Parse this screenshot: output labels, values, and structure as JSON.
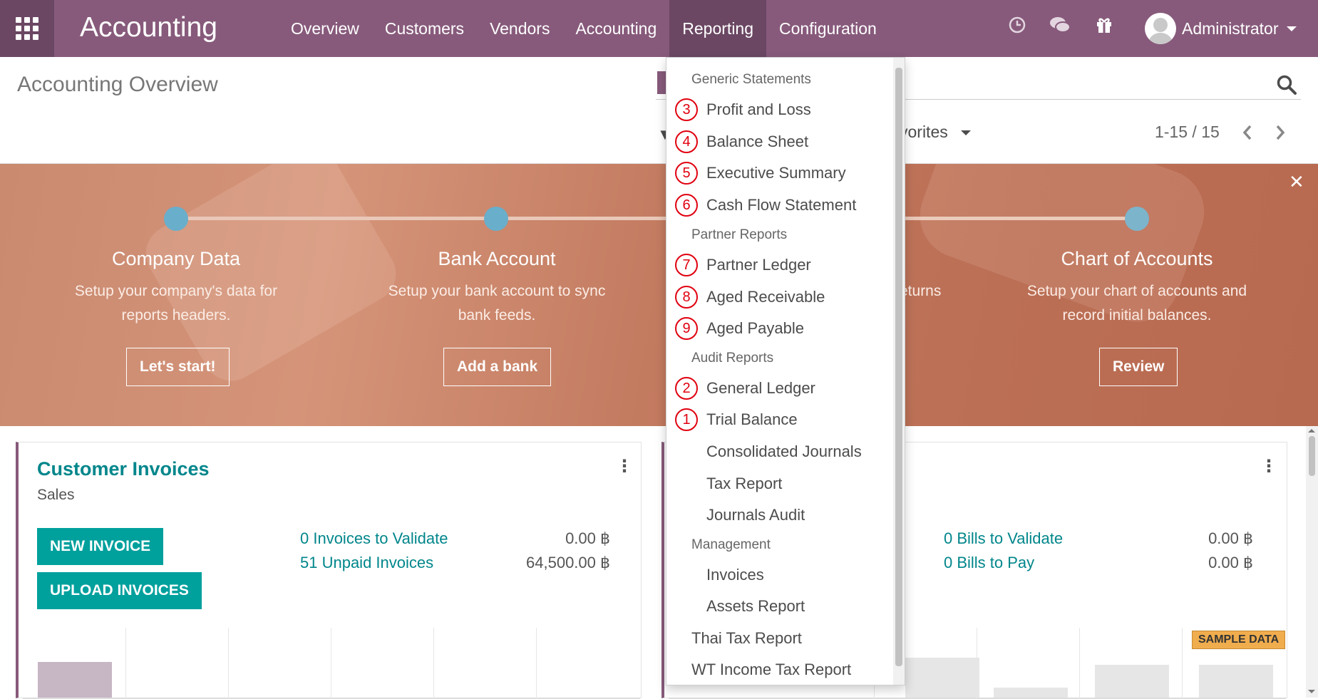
{
  "navbar": {
    "brand": "Accounting",
    "menu": [
      {
        "label": "Overview",
        "active": false
      },
      {
        "label": "Customers",
        "active": false
      },
      {
        "label": "Vendors",
        "active": false
      },
      {
        "label": "Accounting",
        "active": false
      },
      {
        "label": "Reporting",
        "active": true
      },
      {
        "label": "Configuration",
        "active": false
      }
    ],
    "icons": [
      "clock-icon",
      "chat-icon",
      "gift-icon"
    ],
    "user": "Administrator",
    "colors": {
      "primary": "#875a7b",
      "active": "#6b4763"
    }
  },
  "control_panel": {
    "title": "Accounting Overview",
    "favorites": "vorites",
    "pager": "1-15 / 15"
  },
  "banner": {
    "steps": [
      {
        "title": "Company Data",
        "desc1": "Setup your company's data for",
        "desc2": "reports headers.",
        "button": "Let's start!"
      },
      {
        "title": "Bank Account",
        "desc1": "Setup your bank account to sync",
        "desc2": "bank feeds.",
        "button": "Add a bank"
      },
      {
        "title": "",
        "desc1": "eturns",
        "desc2": "",
        "button": ""
      },
      {
        "title": "Chart of Accounts",
        "desc1": "Setup your chart of accounts and",
        "desc2": "record initial balances.",
        "button": "Review"
      }
    ],
    "close": "✕"
  },
  "cards": {
    "customer": {
      "title": "Customer Invoices",
      "subtitle": "Sales",
      "buttons": [
        "NEW INVOICE",
        "UPLOAD INVOICES"
      ],
      "rows": [
        {
          "label": "0 Invoices to Validate",
          "amount": "0.00 ฿"
        },
        {
          "label": "51 Unpaid Invoices",
          "amount": "64,500.00 ฿"
        }
      ]
    },
    "vendor": {
      "rows": [
        {
          "label": "0 Bills to Validate",
          "amount": "0.00 ฿"
        },
        {
          "label": "0 Bills to Pay",
          "amount": "0.00 ฿"
        }
      ],
      "badge": "SAMPLE DATA"
    }
  },
  "reporting_menu": {
    "sections": [
      {
        "header": "Generic Statements",
        "items": [
          {
            "num": "3",
            "label": "Profit and Loss"
          },
          {
            "num": "4",
            "label": "Balance Sheet"
          },
          {
            "num": "5",
            "label": "Executive Summary"
          },
          {
            "num": "6",
            "label": "Cash Flow Statement"
          }
        ]
      },
      {
        "header": "Partner Reports",
        "items": [
          {
            "num": "7",
            "label": "Partner Ledger"
          },
          {
            "num": "8",
            "label": "Aged Receivable"
          },
          {
            "num": "9",
            "label": "Aged Payable"
          }
        ]
      },
      {
        "header": "Audit Reports",
        "items": [
          {
            "num": "2",
            "label": "General Ledger"
          },
          {
            "num": "1",
            "label": "Trial Balance"
          },
          {
            "num": "",
            "label": "Consolidated Journals"
          },
          {
            "num": "",
            "label": "Tax Report"
          },
          {
            "num": "",
            "label": "Journals Audit"
          }
        ]
      },
      {
        "header": "Management",
        "items": [
          {
            "num": "",
            "label": "Invoices"
          },
          {
            "num": "",
            "label": "Assets Report"
          }
        ]
      }
    ],
    "top_level": [
      "Thai Tax Report",
      "WT Income Tax Report"
    ],
    "annotation_color": "#e0000f"
  }
}
